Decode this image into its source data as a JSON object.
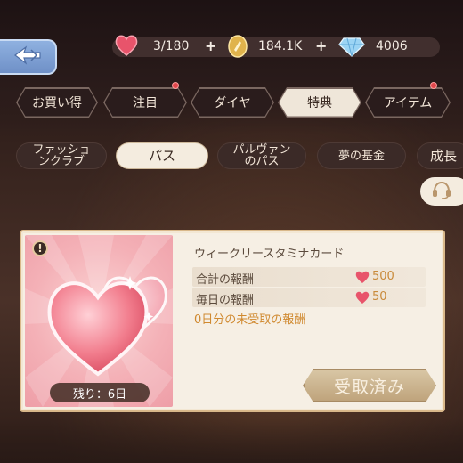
{
  "resources": {
    "stamina": "3/180",
    "gold": "184.1K",
    "diamond": "4006",
    "plus": "+"
  },
  "main_tabs": [
    {
      "label": "お買い得",
      "active": false,
      "dot": false
    },
    {
      "label": "注目",
      "active": false,
      "dot": true
    },
    {
      "label": "ダイヤ",
      "active": false,
      "dot": false
    },
    {
      "label": "特典",
      "active": true,
      "dot": false
    },
    {
      "label": "アイテム",
      "active": false,
      "dot": true
    }
  ],
  "sub_tabs": [
    {
      "label": "ファッショ\nンクラブ",
      "active": false
    },
    {
      "label": "パス",
      "active": true
    },
    {
      "label": "パルヴァン\nのパス",
      "active": false
    },
    {
      "label": "夢の基金",
      "active": false
    },
    {
      "label": "成長",
      "active": false
    }
  ],
  "card": {
    "info_badge": "!",
    "remaining": "残り：6日",
    "title": "ウィークリースタミナカード",
    "rewards": [
      {
        "label": "合計の報酬",
        "value": "500"
      },
      {
        "label": "毎日の報酬",
        "value": "50"
      }
    ],
    "unclaimed": "0日分の未受取の報酬",
    "button_label": "受取済み"
  },
  "colors": {
    "accent_heart": "#e8546b",
    "reward_value": "#c98a3a",
    "unclaimed_text": "#d0892f",
    "notification_dot": "#e0474c"
  },
  "icons": {
    "back": "back-arrow-icon",
    "stamina": "heart-icon",
    "gold": "coin-icon",
    "diamond": "diamond-icon",
    "support": "headset-icon"
  }
}
